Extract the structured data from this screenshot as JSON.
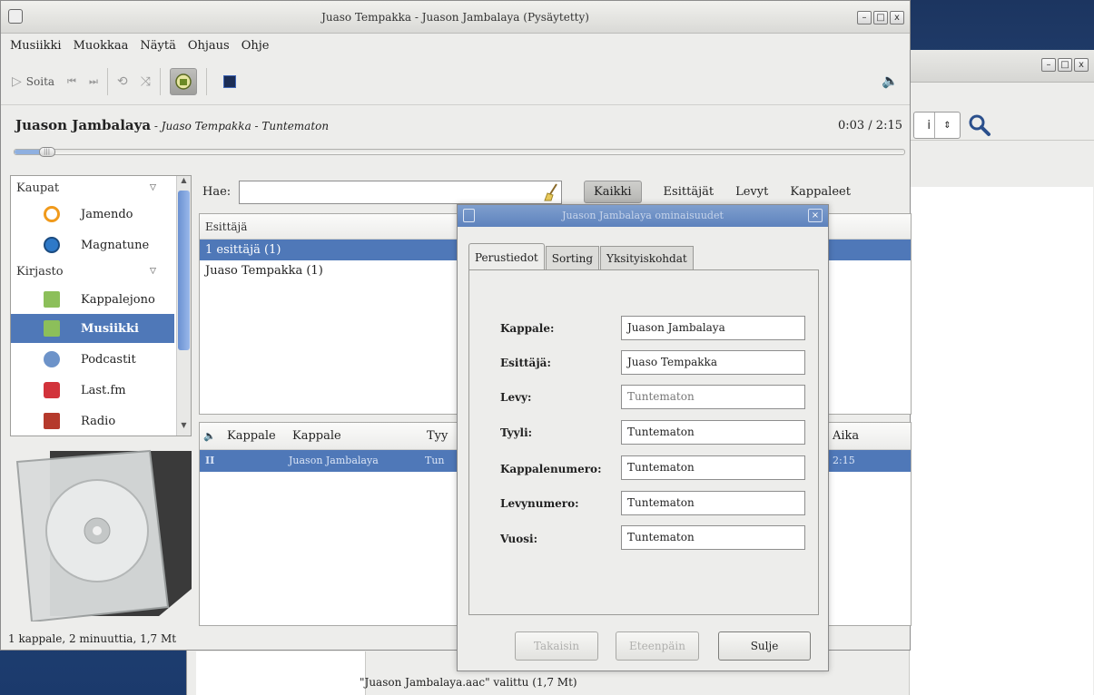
{
  "main_window": {
    "title": "Juaso Tempakka - Juason Jambalaya (Pysäytetty)",
    "controls": [
      "–",
      "□",
      "x"
    ]
  },
  "menu": [
    "Musiikki",
    "Muokkaa",
    "Näytä",
    "Ohjaus",
    "Ohje"
  ],
  "toolbar": {
    "play_label": "Soita"
  },
  "now_playing": {
    "title": "Juason Jambalaya",
    "meta": " - Juaso Tempakka - Tuntematon",
    "time": "0:03 / 2:15",
    "progress": 0.023
  },
  "sidebar": {
    "group_stores": "Kaupat",
    "group_library": "Kirjasto",
    "items": [
      {
        "label": "Jamendo"
      },
      {
        "label": "Magnatune"
      },
      {
        "label": "Kappalejono"
      },
      {
        "label": "Musiikki"
      },
      {
        "label": "Podcastit"
      },
      {
        "label": "Last.fm"
      },
      {
        "label": "Radio"
      }
    ]
  },
  "status_bar": "1 kappale, 2 minuuttia, 1,7 Mt",
  "browser": {
    "search_label": "Hae:",
    "search_value": "",
    "filters": [
      "Kaikki",
      "Esittäjät",
      "Levyt",
      "Kappaleet"
    ],
    "artist_header": "Esittäjä",
    "artists": [
      "1 esittäjä (1)",
      "Juaso Tempakka (1)"
    ],
    "track_columns": [
      "Kappale",
      "Kappale",
      "Tyy",
      "Aika"
    ],
    "track_row": {
      "num": "II",
      "title": "Juason Jambalaya",
      "genre": "Tun",
      "time": "2:15"
    }
  },
  "dialog": {
    "title": "Juason Jambalaya ominaisuudet",
    "tabs": [
      "Perustiedot",
      "Sorting",
      "Yksityiskohdat"
    ],
    "fields": [
      {
        "label": "Kappale:",
        "value": "Juason Jambalaya"
      },
      {
        "label": "Esittäjä:",
        "value": "Juaso Tempakka"
      },
      {
        "label": "Levy:",
        "value": "Tuntematon"
      },
      {
        "label": "Tyyli:",
        "value": "Tuntematon"
      },
      {
        "label": "Kappalenumero:",
        "value": "Tuntematon"
      },
      {
        "label": "Levynumero:",
        "value": "Tuntematon"
      },
      {
        "label": "Vuosi:",
        "value": "Tuntematon"
      }
    ],
    "buttons": {
      "back": "Takaisin",
      "forward": "Eteenpäin",
      "close": "Sulje"
    }
  },
  "background_window": {
    "status": "\"Juason Jambalaya.aac\" valittu (1,7 Mt)",
    "spinner_value": "i",
    "controls": [
      "–",
      "□",
      "x"
    ]
  },
  "colors": {
    "selection": "#4f78b8",
    "dialog_title": "#6a8cc4"
  }
}
